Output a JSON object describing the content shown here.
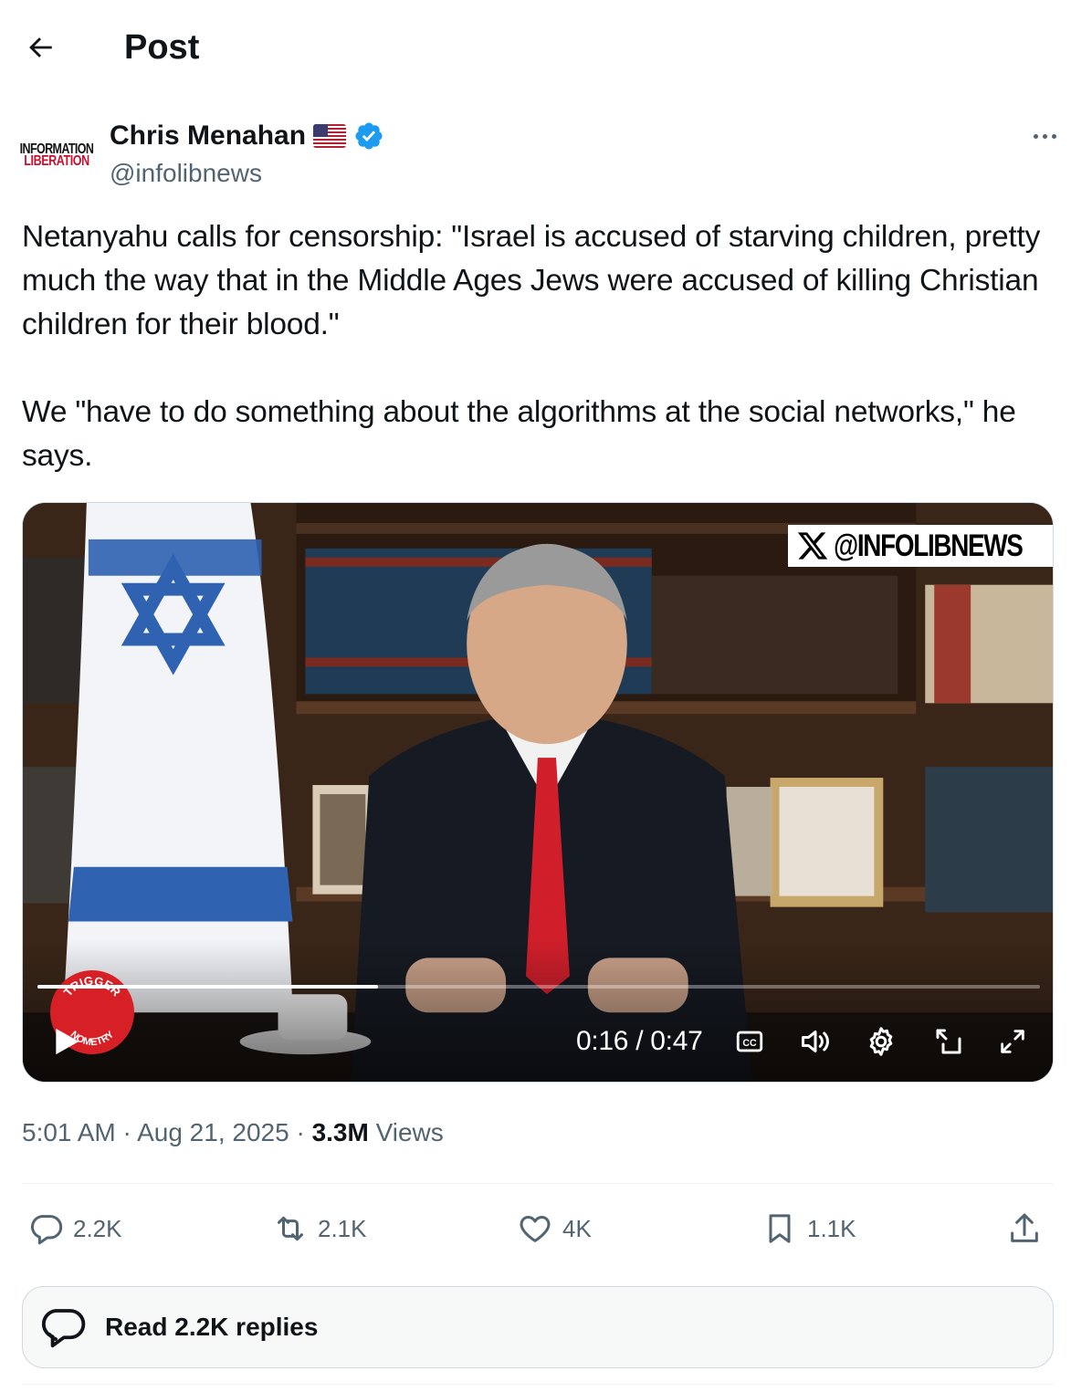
{
  "header": {
    "title": "Post"
  },
  "author": {
    "avatar_text_line1": "INFORMATION",
    "avatar_text_line2": "LIBERATION",
    "name": "Chris Menahan",
    "handle": "@infolibnews",
    "verified": true,
    "flag_icon": "us-flag-icon"
  },
  "post": {
    "text": "Netanyahu calls for censorship: \"Israel is accused of starving children, pretty much the way that in the Middle Ages Jews were accused of killing Christian children for their blood.\"\n\nWe \"have to do something about the algorithms at the social networks,\" he says."
  },
  "video": {
    "watermark": "@INFOLIBNEWS",
    "badge_top": "TRIGGER",
    "badge_bottom": "NOMETRY",
    "time_display": "0:16 / 0:47",
    "progress_fraction": 0.34,
    "controls": [
      "play-icon",
      "captions-icon",
      "volume-icon",
      "settings-icon",
      "pip-icon",
      "fullscreen-icon"
    ]
  },
  "meta": {
    "time": "5:01 AM",
    "date": "Aug 21, 2025",
    "views_count": "3.3M",
    "views_label": "Views",
    "separator": "·"
  },
  "actions": {
    "replies": "2.2K",
    "reposts": "2.1K",
    "likes": "4K",
    "bookmarks": "1.1K"
  },
  "read_replies": {
    "label": "Read 2.2K replies"
  },
  "colors": {
    "text": "#0f1419",
    "secondary": "#536471",
    "verified": "#1d9bf0",
    "border": "#cfd9de"
  }
}
